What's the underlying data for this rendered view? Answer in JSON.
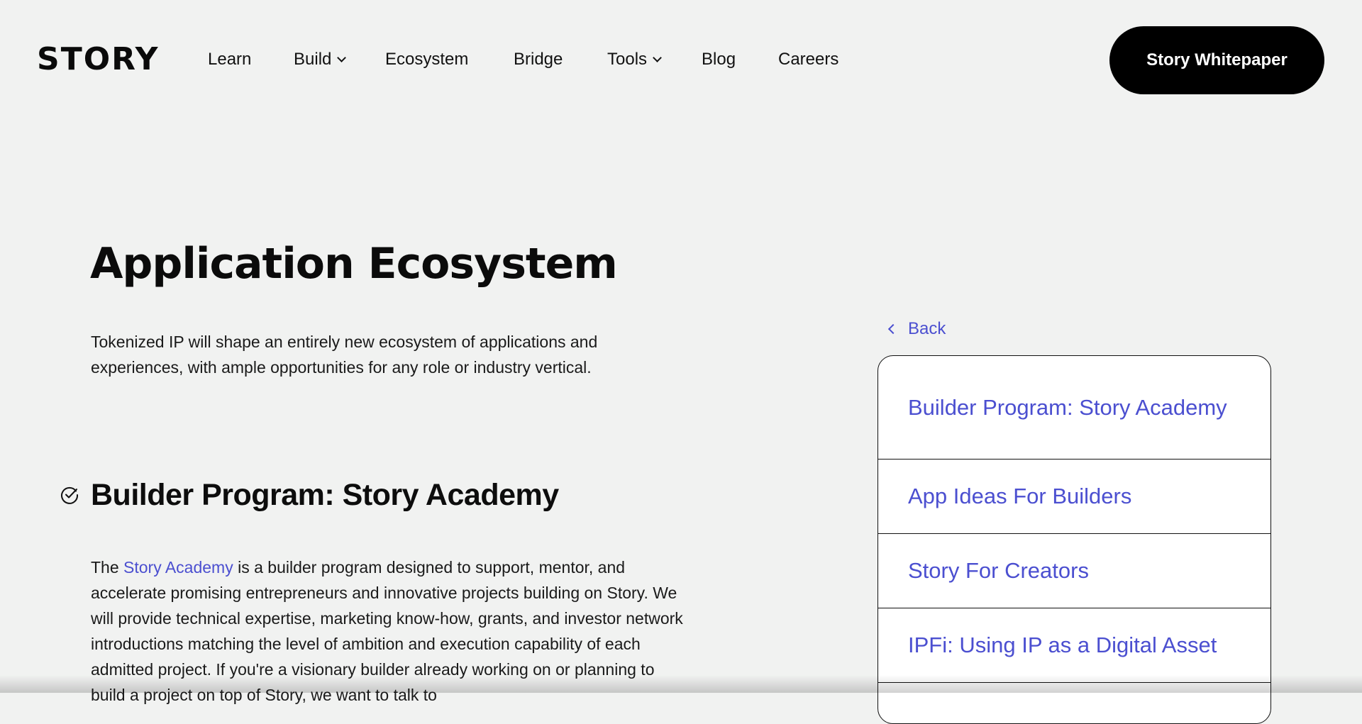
{
  "header": {
    "logo": "STORY",
    "nav": [
      {
        "label": "Learn",
        "dropdown": false
      },
      {
        "label": "Build",
        "dropdown": true
      },
      {
        "label": "Ecosystem",
        "dropdown": false
      },
      {
        "label": "Bridge",
        "dropdown": false
      },
      {
        "label": "Tools",
        "dropdown": true
      },
      {
        "label": "Blog",
        "dropdown": false
      },
      {
        "label": "Careers",
        "dropdown": false
      }
    ],
    "cta_label": "Story Whitepaper"
  },
  "main": {
    "title": "Application Ecosystem",
    "intro": "Tokenized IP will shape an entirely new ecosystem of applications and experiences, with ample opportunities for any role or industry vertical.",
    "section": {
      "icon": "check-circle-icon",
      "title": "Builder Program: Story Academy",
      "body_prefix": "The ",
      "body_link": "Story Academy",
      "body_rest": " is a builder program designed to support, mentor, and accelerate promising entrepreneurs and innovative projects building on Story. We will provide technical expertise, marketing know-how, grants, and investor network introductions matching the level of ambition and execution capability of each admitted project. If you're a visionary builder already working on or planning to build a project on top of Story, we want to talk to"
    }
  },
  "sidebar": {
    "back_label": "Back",
    "toc": [
      "Builder Program: Story Academy",
      "App Ideas For Builders",
      "Story For Creators",
      "IPFi: Using IP as a Digital Asset"
    ]
  },
  "colors": {
    "background": "#f1f2f1",
    "accent": "#4b4fd0",
    "cta_bg": "#000000",
    "cta_text": "#ffffff"
  }
}
